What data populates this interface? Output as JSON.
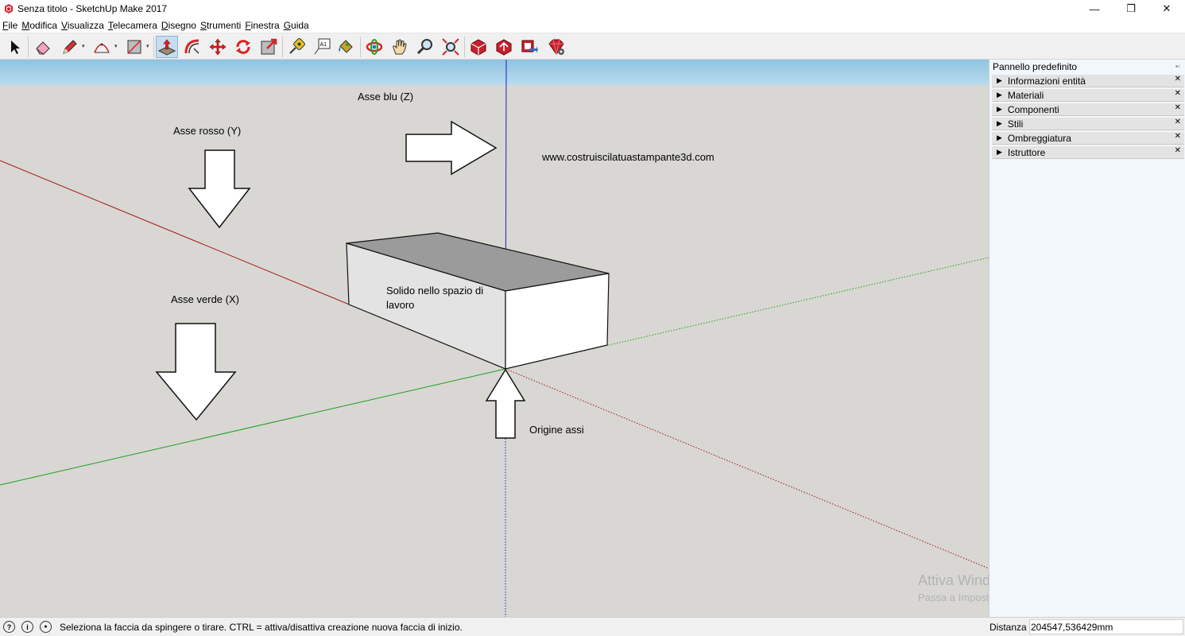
{
  "window": {
    "title": "Senza titolo - SketchUp Make 2017",
    "minimize_glyph": "—",
    "maximize_glyph": "❐",
    "close_glyph": "✕"
  },
  "menu": [
    "File",
    "Modifica",
    "Visualizza",
    "Telecamera",
    "Disegno",
    "Strumenti",
    "Finestra",
    "Guida"
  ],
  "toolbar": {
    "tools": [
      {
        "name": "select-tool-icon"
      },
      {
        "name": "eraser-tool-icon"
      },
      {
        "name": "pencil-tool-icon"
      },
      {
        "name": "arc-tool-icon"
      },
      {
        "name": "rectangle-tool-icon"
      },
      {
        "name": "push-pull-tool-icon",
        "active": true
      },
      {
        "name": "offset-tool-icon"
      },
      {
        "name": "move-tool-icon"
      },
      {
        "name": "rotate-tool-icon"
      },
      {
        "name": "scale-tool-icon"
      },
      {
        "name": "tape-measure-tool-icon"
      },
      {
        "name": "text-tool-icon"
      },
      {
        "name": "paint-bucket-tool-icon"
      },
      {
        "name": "orbit-tool-icon"
      },
      {
        "name": "pan-tool-icon"
      },
      {
        "name": "zoom-tool-icon"
      },
      {
        "name": "zoom-extents-tool-icon"
      },
      {
        "name": "3d-warehouse-icon"
      },
      {
        "name": "share-model-icon"
      },
      {
        "name": "extension-warehouse-icon"
      },
      {
        "name": "extension-manager-icon"
      }
    ],
    "text_tool_glyph": "A1",
    "dropdown_glyph": "▾"
  },
  "viewport": {
    "annotations": {
      "blue_axis": "Asse blu (Z)",
      "red_axis": "Asse rosso (Y)",
      "green_axis": "Asse verde (X)",
      "website": "www.costruiscilatuastampante3d.com",
      "solid": "Solido nello spazio di lavoro",
      "origin": "Origine assi"
    },
    "colors": {
      "background": "#d8d7d3",
      "red_axis": "#a31414",
      "green_axis": "#1f9e1f",
      "blue_axis": "#1f1fc4",
      "top_face": "#9b9b9b",
      "side_face": "#e3e3e3",
      "front_face": "#ffffff"
    },
    "watermark": {
      "title": "Attiva Windows",
      "subtitle": "Passa a Impostazioni per attivare Windows."
    }
  },
  "tray": {
    "title": "Pannello predefinito",
    "pin_glyph": "▪▫",
    "sections": [
      {
        "label": "Informazioni entità",
        "name": "tray-section-entity-info"
      },
      {
        "label": "Materiali",
        "name": "tray-section-materials"
      },
      {
        "label": "Componenti",
        "name": "tray-section-components"
      },
      {
        "label": "Stili",
        "name": "tray-section-styles"
      },
      {
        "label": "Ombreggiatura",
        "name": "tray-section-shadows"
      },
      {
        "label": "Istruttore",
        "name": "tray-section-instructor"
      }
    ],
    "expand_glyph": "▶",
    "close_glyph": "✕"
  },
  "status": {
    "geo_icon_glyph": "?",
    "info_icon_glyph": "i",
    "user_icon_glyph": "●",
    "text": "Seleziona la faccia da spingere o tirare.  CTRL = attiva/disattiva creazione nuova faccia di inizio.",
    "measurement_label": "Distanza",
    "measurement_value": "204547,536429mm"
  }
}
